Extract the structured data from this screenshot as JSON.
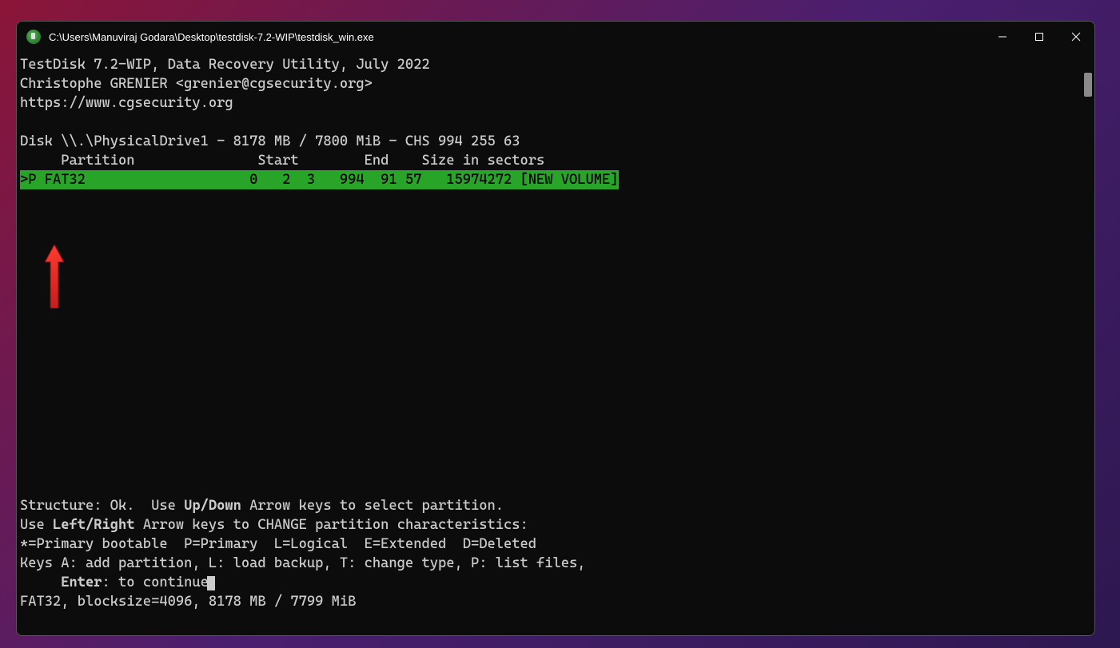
{
  "titlebar": {
    "title": "C:\\Users\\Manuviraj Godara\\Desktop\\testdisk-7.2-WIP\\testdisk_win.exe"
  },
  "header": {
    "line1": "TestDisk 7.2-WIP, Data Recovery Utility, July 2022",
    "line2": "Christophe GRENIER <grenier@cgsecurity.org>",
    "line3": "https://www.cgsecurity.org"
  },
  "disk_info": "Disk \\\\.\\PhysicalDrive1 - 8178 MB / 7800 MiB - CHS 994 255 63",
  "table_header": "     Partition               Start        End    Size in sectors",
  "partition_row": ">P FAT32                    0   2  3   994  91 57   15974272 [NEW VOLUME]",
  "footer": {
    "structure": "Structure: Ok.  Use ",
    "updown": "Up/Down",
    "structure2": " Arrow keys to select partition.",
    "use": "Use ",
    "leftright": "Left/Right",
    "use2": " Arrow keys to CHANGE partition characteristics:",
    "legend": "*=Primary bootable  P=Primary  L=Logical  E=Extended  D=Deleted",
    "keys": "Keys A: add partition, L: load backup, T: change type, P: list files,",
    "enter_label": "     Enter",
    "enter_rest": ": to continue",
    "fsinfo": "FAT32, blocksize=4096, 8178 MB / 7799 MiB"
  }
}
